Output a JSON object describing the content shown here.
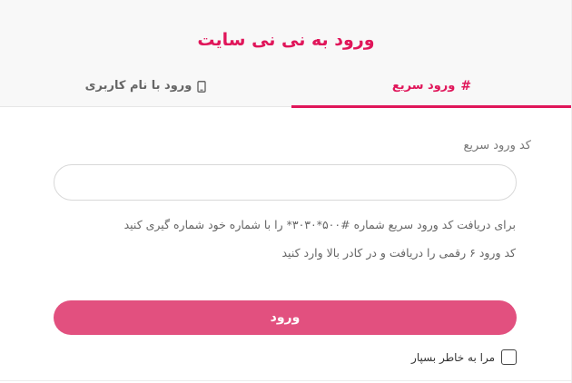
{
  "header": {
    "title": "ورود به نی نی سایت"
  },
  "tabs": {
    "quick_login": {
      "icon": "hash-icon",
      "glyph": "#",
      "label": "ورود سریع"
    },
    "username_login": {
      "icon": "mobile-phone-icon",
      "label": "ورود با نام کاربری"
    }
  },
  "form": {
    "code_label": "کد ورود سریع",
    "code_value": "",
    "hint_line1": "برای دریافت کد ورود سریع شماره #۵۰۰*۳۰۳۰* را با شماره خود شماره گیری کنید",
    "hint_line2": "کد ورود ۶ رقمی را دریافت و در کادر بالا وارد کنید",
    "submit_label": "ورود",
    "remember_label": "مرا به خاطر بسپار",
    "remember_checked": false
  },
  "colors": {
    "accent": "#e0165a",
    "button": "#e2507f"
  }
}
